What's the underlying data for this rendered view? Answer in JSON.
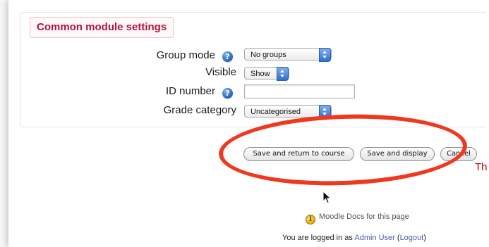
{
  "section": {
    "legend": "Common module settings"
  },
  "fields": {
    "group_mode": {
      "label": "Group mode",
      "value": "No groups"
    },
    "visible": {
      "label": "Visible",
      "value": "Show"
    },
    "id_number": {
      "label": "ID number",
      "value": ""
    },
    "grade_category": {
      "label": "Grade category",
      "value": "Uncategorised"
    }
  },
  "buttons": {
    "save_return": "Save and return to course",
    "save_display": "Save and display",
    "cancel": "Cancel"
  },
  "truncated_text": "Th",
  "footer": {
    "docs_link": "Moodle Docs for this page",
    "logged_in_prefix": "You are logged in as ",
    "user_name": "Admin User",
    "logout_label": "Logout"
  },
  "annotation": {
    "color": "#f0381f"
  },
  "colors": {
    "legend_text": "#b0143c",
    "help_icon": "#1f62c1",
    "link": "#4a5fa6"
  },
  "icons": {
    "help": "help-icon",
    "info": "info-icon",
    "select": "select-arrows-icon",
    "pointer": "mouse-pointer-icon"
  }
}
